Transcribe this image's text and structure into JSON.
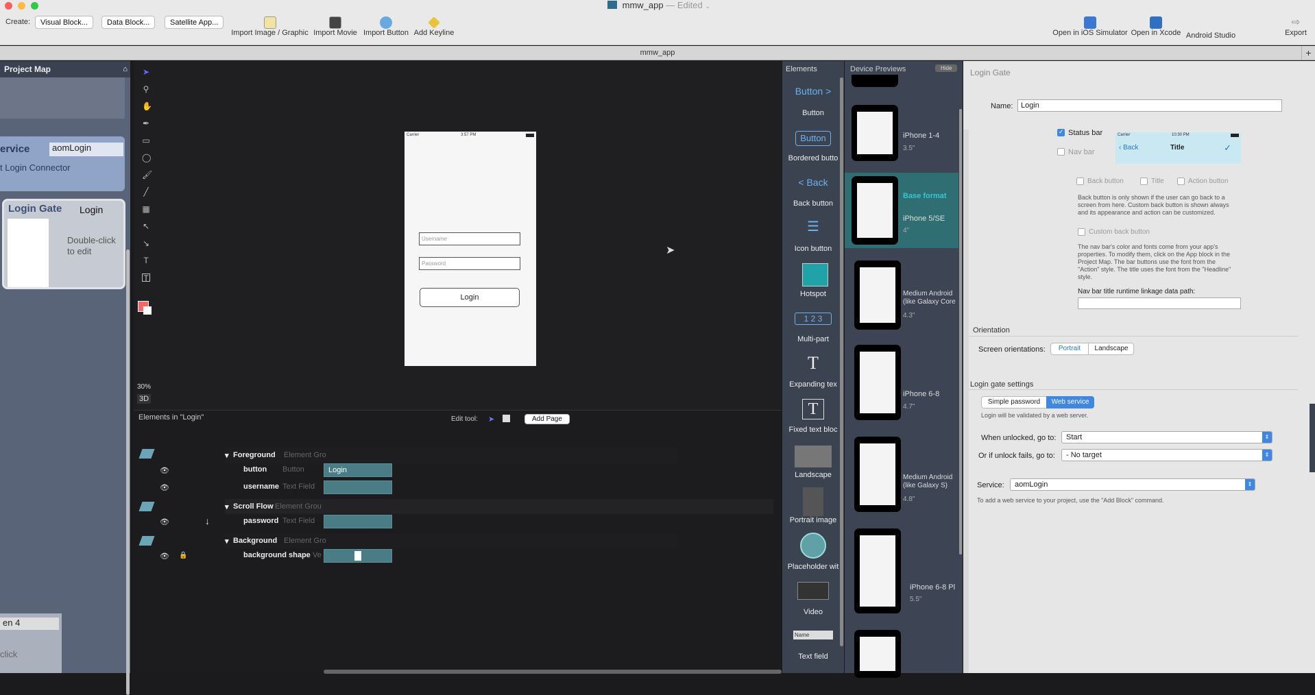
{
  "window": {
    "title": "mmw_app",
    "edited": "— Edited",
    "tab_title": "mmw_app"
  },
  "toolbar": {
    "create_label": "Create:",
    "visual_block": "Visual Block...",
    "data_block": "Data Block...",
    "satellite_app": "Satellite App...",
    "import_image": "Import Image / Graphic",
    "import_movie": "Import Movie",
    "import_button": "Import Button",
    "add_keyline": "Add Keyline",
    "open_ios_sim": "Open in iOS Simulator",
    "open_xcode": "Open in Xcode",
    "android_studio": "Android Studio",
    "export": "Export"
  },
  "project_map": {
    "title": "Project Map",
    "service_label": "ervice",
    "service_name": "aomLogin",
    "connector": "t Login Connector",
    "login_gate_title": "Login Gate",
    "login_gate_name": "Login",
    "double_click": "Double-click",
    "to_edit": "to edit",
    "screen4_label": "en 4",
    "click_label": "click"
  },
  "canvas": {
    "zoom": "30%",
    "three_d": "3D",
    "phone": {
      "carrier": "Carrier",
      "time": "3:57 PM",
      "username_placeholder": "Username",
      "password_placeholder": "Password",
      "login_button": "Login"
    }
  },
  "elements_panel": {
    "title": "Elements in \"Login\"",
    "edit_tool": "Edit tool:",
    "add_page": "Add Page",
    "rows": [
      {
        "name": "Foreground",
        "type": "Element Gro"
      },
      {
        "name": "button",
        "type": "Button",
        "value": "Login"
      },
      {
        "name": "username",
        "type": "Text Field"
      },
      {
        "name": "Scroll Flow",
        "type": "Element Grou"
      },
      {
        "name": "password",
        "type": "Text Field"
      },
      {
        "name": "Background",
        "type": "Element Gro"
      },
      {
        "name": "background shape",
        "type": "Ve"
      }
    ]
  },
  "palette": {
    "title": "Elements",
    "items": [
      {
        "icon_text": "Button >",
        "label": "Button"
      },
      {
        "icon_text": "Button",
        "label": "Bordered butto"
      },
      {
        "icon_text": "< Back",
        "label": "Back button"
      },
      {
        "icon_text": "",
        "label": "Icon button"
      },
      {
        "icon_text": "",
        "label": "Hotspot"
      },
      {
        "icon_text": "1 2 3",
        "label": "Multi-part"
      },
      {
        "icon_text": "T",
        "label": "Expanding tex"
      },
      {
        "icon_text": "T",
        "label": "Fixed text bloc"
      },
      {
        "icon_text": "",
        "label": "Landscape"
      },
      {
        "icon_text": "",
        "label": "Portrait image"
      },
      {
        "icon_text": "",
        "label": "Placeholder wit"
      },
      {
        "icon_text": "",
        "label": "Video"
      },
      {
        "icon_text": "Name",
        "label": "Text field"
      }
    ]
  },
  "device_previews": {
    "title": "Device Previews",
    "hide": "Hide",
    "devices": [
      {
        "name": "iPhone 1-4",
        "size": "3.5\""
      },
      {
        "name": "iPhone 5/SE",
        "size": "4\"",
        "badge": "Base format"
      },
      {
        "name": "Medium Android (like Galaxy Core",
        "size": "4.3\""
      },
      {
        "name": "iPhone 6-8",
        "size": "4.7\""
      },
      {
        "name": "Medium Android (like Galaxy S)",
        "size": "4.8\""
      },
      {
        "name": "iPhone 6-8 Pl",
        "size": "5.5\""
      }
    ]
  },
  "inspector": {
    "title": "Login Gate",
    "name_label": "Name:",
    "name_value": "Login",
    "status_bar": "Status bar",
    "nav_bar": "Nav bar",
    "preview_carrier": "Carrier",
    "preview_time": "10:30 PM",
    "preview_back": "Back",
    "preview_title": "Title",
    "back_button": "Back button",
    "title_cb": "Title",
    "action_button": "Action button",
    "back_note": "Back button is only shown if the user can go back to a screen from here. Custom back button is shown always and its appearance and action can be customized.",
    "custom_back": "Custom back button",
    "color_note": "The nav bar's color and fonts come from your app's properties. To modify them, click on the App block in the Project Map. The bar buttons use the font from the \"Action\" style. The title uses the font from the \"Headline\" style.",
    "nav_linkage": "Nav bar title runtime linkage data path:",
    "orientation": "Orientation",
    "screen_orient": "Screen orientations:",
    "portrait": "Portrait",
    "landscape": "Landscape",
    "login_gate_settings": "Login gate settings",
    "simple_password": "Simple password",
    "web_service": "Web service",
    "validated_note": "Login will be validated by a web server.",
    "when_unlocked": "When unlocked, go to:",
    "when_unlocked_value": "Start",
    "unlock_fails": "Or if unlock fails, go to:",
    "unlock_fails_value": "- No target",
    "service_label": "Service:",
    "service_value": "aomLogin",
    "add_service_note": "To add a web service to your project, use the \"Add Block\" command."
  }
}
